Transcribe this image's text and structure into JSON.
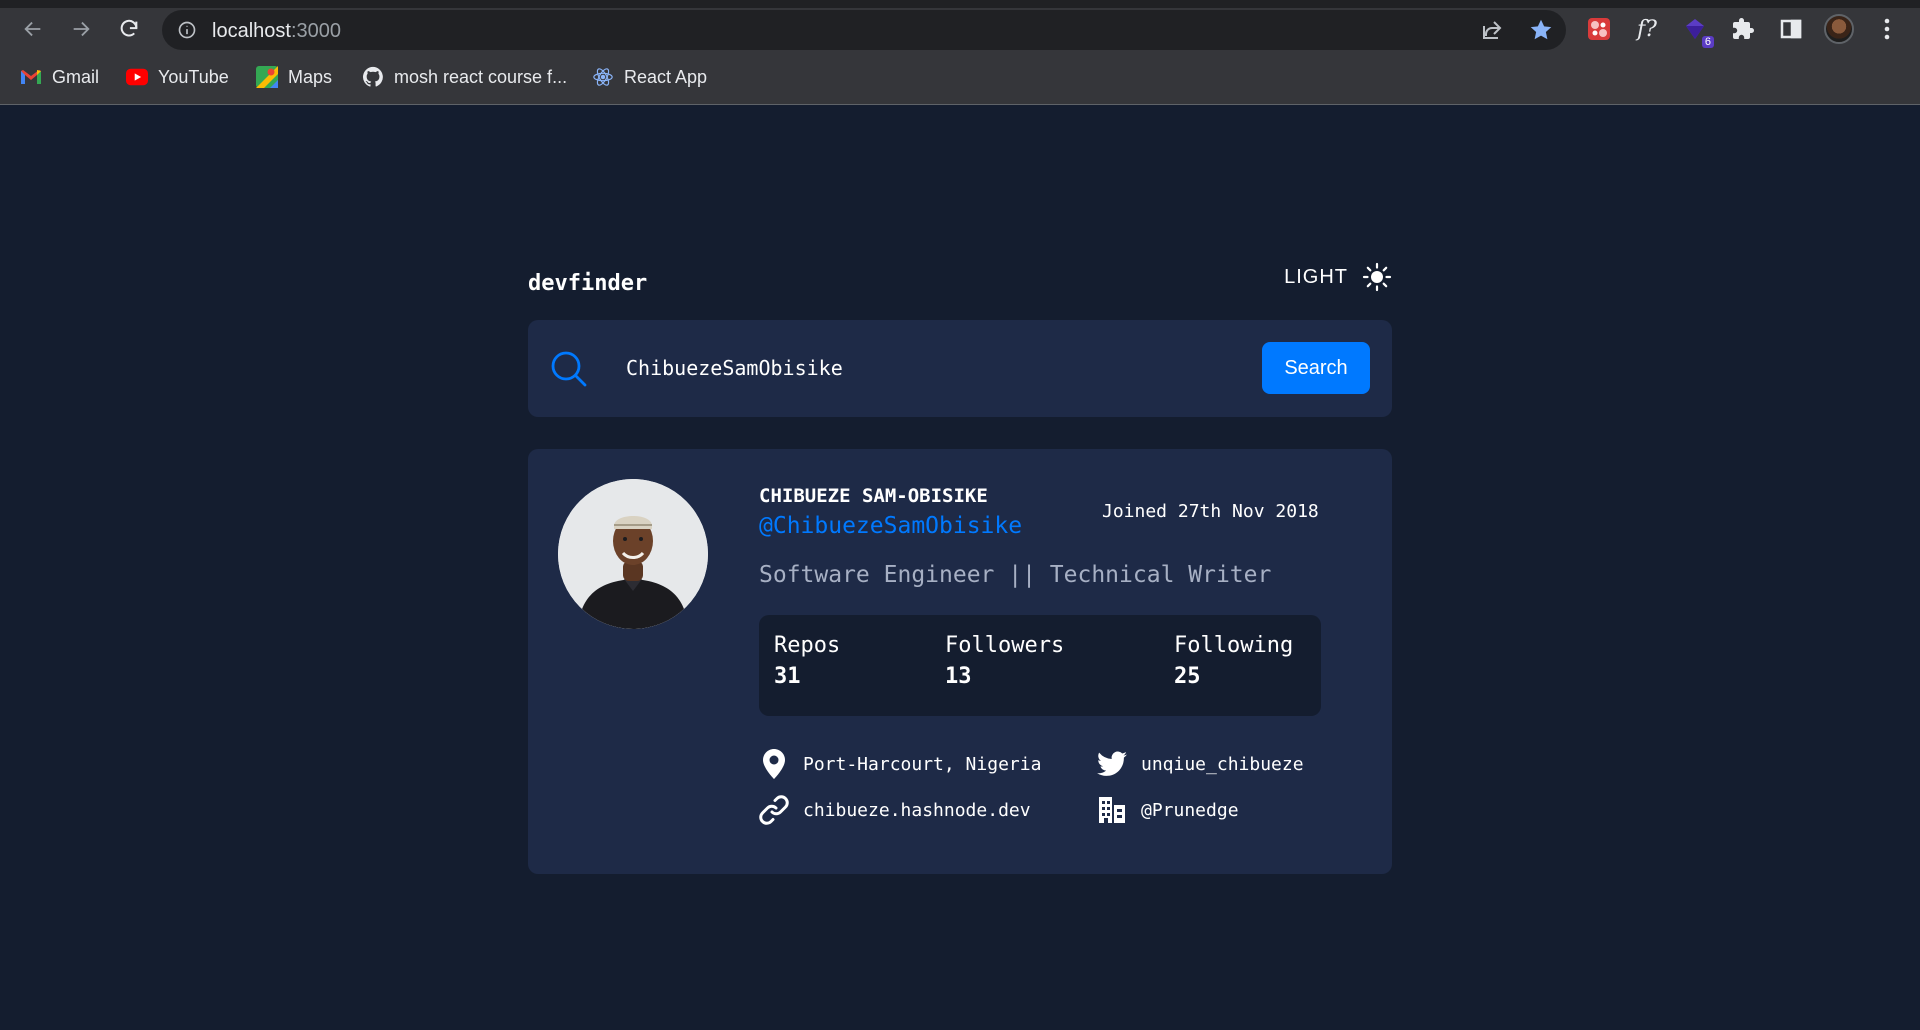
{
  "browser": {
    "url_host": "localhost",
    "url_port": ":3000",
    "bookmarks": [
      {
        "label": "Gmail",
        "icon": "gmail-icon"
      },
      {
        "label": "YouTube",
        "icon": "youtube-icon"
      },
      {
        "label": "Maps",
        "icon": "maps-icon"
      },
      {
        "label": "mosh react course f...",
        "icon": "github-icon"
      },
      {
        "label": "React App",
        "icon": "react-icon"
      }
    ],
    "extensions": {
      "fx_label": "f?",
      "badge_count": "6"
    },
    "colors": {
      "chrome": "#35363a",
      "omnibox": "#202124",
      "star": "#8ab4f8"
    }
  },
  "app": {
    "logo": "devfinder",
    "theme_label": "LIGHT",
    "search": {
      "value": "ChibuezeSamObisike",
      "button_label": "Search"
    },
    "profile": {
      "name": "CHIBUEZE SAM-OBISIKE",
      "handle": "@ChibuezeSamObisike",
      "joined": "Joined 27th Nov 2018",
      "bio": "Software Engineer || Technical Writer",
      "stats": [
        {
          "label": "Repos",
          "value": "31"
        },
        {
          "label": "Followers",
          "value": "13"
        },
        {
          "label": "Following",
          "value": "25"
        }
      ],
      "location": "Port-Harcourt, Nigeria",
      "website": "chibueze.hashnode.dev",
      "twitter": "unqiue_chibueze",
      "company": "@Prunedge"
    },
    "colors": {
      "background": "#141d2f",
      "card": "#1e2a47",
      "accent": "#0079ff",
      "muted": "#a7b0c4"
    }
  }
}
